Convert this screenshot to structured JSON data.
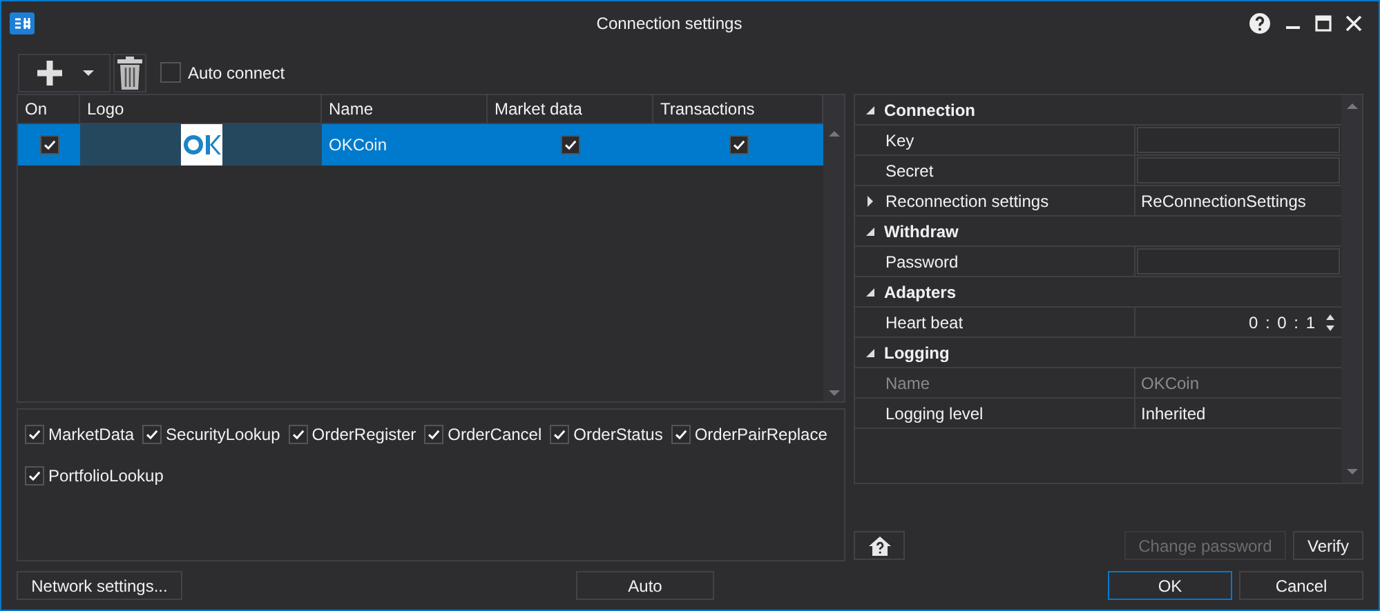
{
  "window": {
    "title": "Connection settings"
  },
  "toolbar": {
    "auto_connect": {
      "label": "Auto connect",
      "checked": false
    }
  },
  "table": {
    "columns": [
      "On",
      "Logo",
      "Name",
      "Market data",
      "Transactions"
    ],
    "rows": [
      {
        "on": true,
        "name": "OKCoin",
        "market_data": true,
        "transactions": true,
        "selected": true
      }
    ]
  },
  "properties": [
    {
      "title": "Connection",
      "expanded": true,
      "rows": [
        {
          "kind": "field",
          "label": "Key"
        },
        {
          "kind": "field",
          "label": "Secret"
        },
        {
          "kind": "expander",
          "label": "Reconnection settings",
          "value": "ReConnectionSettings",
          "expanded": false
        }
      ]
    },
    {
      "title": "Withdraw",
      "expanded": true,
      "rows": [
        {
          "kind": "field",
          "label": "Password"
        }
      ]
    },
    {
      "title": "Adapters",
      "expanded": true,
      "rows": [
        {
          "kind": "spin",
          "label": "Heart beat",
          "value": "0 : 0 : 1"
        }
      ]
    },
    {
      "title": "Logging",
      "expanded": true,
      "rows": [
        {
          "kind": "text",
          "label": "Name",
          "value": "OKCoin",
          "disabled": true
        },
        {
          "kind": "text",
          "label": "Logging level",
          "value": "Inherited",
          "disabled": false
        }
      ]
    }
  ],
  "message_types": [
    {
      "label": "MarketData",
      "checked": true
    },
    {
      "label": "SecurityLookup",
      "checked": true
    },
    {
      "label": "OrderRegister",
      "checked": true
    },
    {
      "label": "OrderCancel",
      "checked": true
    },
    {
      "label": "OrderStatus",
      "checked": true
    },
    {
      "label": "OrderPairReplace",
      "checked": true
    },
    {
      "label": "PortfolioLookup",
      "checked": true
    }
  ],
  "property_buttons": [
    {
      "label": "Change password",
      "disabled": true
    },
    {
      "label": "Verify",
      "disabled": false
    }
  ],
  "buttons": {
    "network": "Network settings...",
    "auto": "Auto",
    "ok": "OK",
    "cancel": "Cancel"
  }
}
